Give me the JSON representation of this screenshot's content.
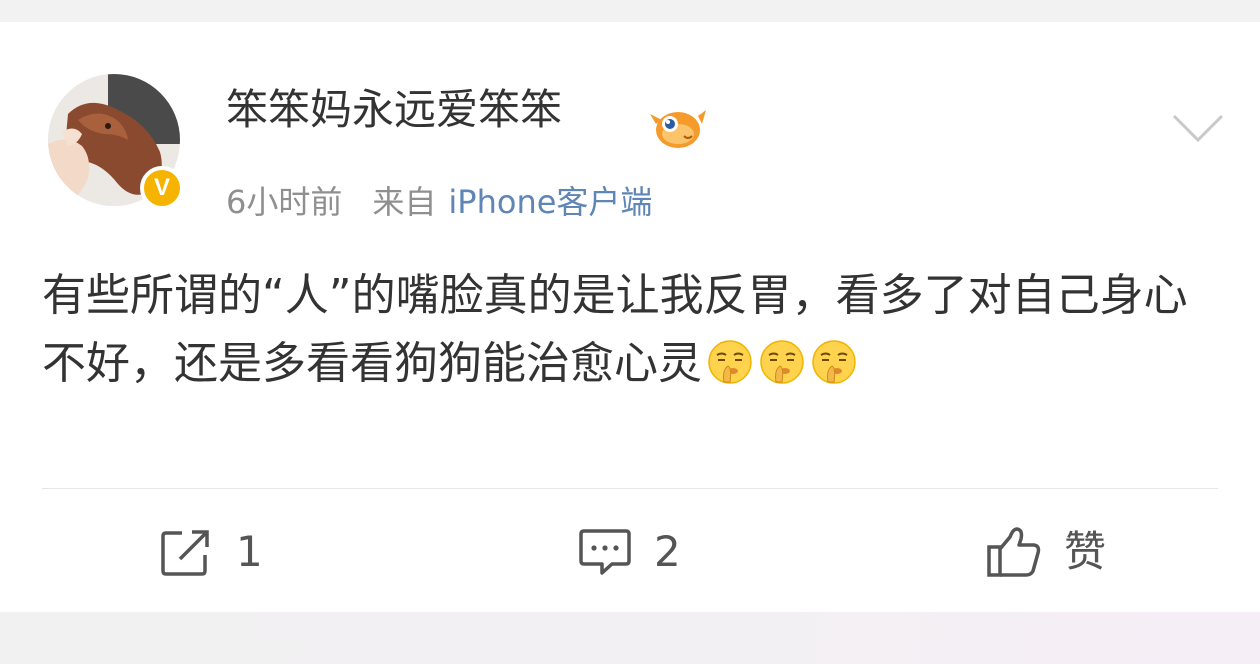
{
  "post": {
    "author": {
      "name": "笨笨妈永远爱笨笨",
      "verified": true,
      "badge_letter": "V",
      "badge_color": "#f6b400",
      "level_icon": "fish-icon"
    },
    "meta": {
      "time": "6小时前",
      "from_label": "来自",
      "client": "iPhone客户端"
    },
    "text": "有些所谓的“人”的嘴脸真的是让我反胃，看多了对自己身心不好，还是多看看狗狗能治愈心灵",
    "emojis": [
      "shush-emoji",
      "shush-emoji",
      "shush-emoji"
    ]
  },
  "actions": {
    "repost": {
      "icon": "repost-icon",
      "label": "1"
    },
    "comment": {
      "icon": "comment-icon",
      "label": "2"
    },
    "like": {
      "icon": "thumbs-up-icon",
      "label": "赞"
    }
  },
  "colors": {
    "text": "#333333",
    "meta": "#8f8f8f",
    "link": "#5f86b5",
    "icon": "#555555"
  }
}
